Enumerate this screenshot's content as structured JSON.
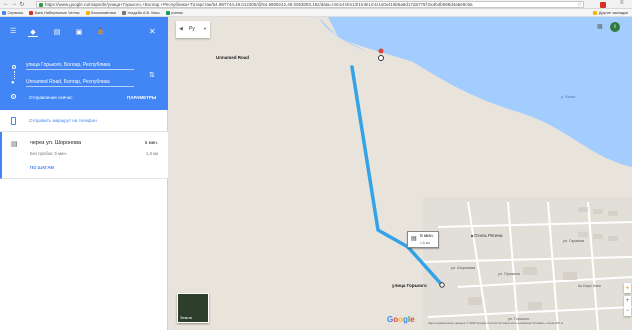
{
  "browser": {
    "back_icon": "back-arrow-icon",
    "forward_icon": "forward-arrow-icon",
    "reload_icon": "reload-icon",
    "url": "https://www.google.ru/maps/dir/улица+Горького,+Болгар,+Республика+Татарстан/54.987744,49.012305/@54.9908242,49.0053083,15z/data=!4m14!4m13!1m5!1m1!1s0x415b5a6d17da775f:0x4b4b068d4a5e9c9a",
    "bookmarks": [
      {
        "label": "Сервисы",
        "color": "#4285f4"
      },
      {
        "label": "Банк Набережные Челны",
        "color": "#d93025"
      },
      {
        "label": "Космонавтика",
        "color": "#f4b400"
      },
      {
        "label": "Усадьба А.В. Маш",
        "color": "#777777"
      },
      {
        "label": "ученик",
        "color": "#0f9d58"
      }
    ],
    "other_bookmarks": "Другие закладки"
  },
  "panel": {
    "origin": "улица Горького, Болгар, Республика",
    "destination": "Unnamed Road, Болгар, Республика",
    "depart_label": "Отправление сейчас",
    "options_label": "ПАРАМЕТРЫ",
    "send_label": "Отправить маршрут на телефон",
    "route": {
      "via": "через ул. Шоронова",
      "traffic": "Без пробок: 5 мин.",
      "duration": "5 мин.",
      "distance": "1,6 км",
      "steps_label": "ПО ШАГАМ"
    }
  },
  "map": {
    "language": "Ру",
    "labels": {
      "destination": "Unnamed Road",
      "origin": "улица Горького",
      "hotel": "Отель Регина",
      "street1": "ул. Шоронова",
      "street2": "ул. Пушкина",
      "street3": "ул. Гаражна",
      "street4": "ул. Горького",
      "shop": "Ак Барс банк",
      "river": "р. Волга"
    },
    "time_box": {
      "duration": "5 мин.",
      "distance": "1,6 км"
    },
    "earth_label": "Земля",
    "google": "Google",
    "footer": "Картографические данные © 2016 Google   Россия   Условия использования   Оставить отзыв   200 м"
  },
  "colors": {
    "accent": "#4285f4",
    "route": "#33a2e6",
    "water": "#a3ccff",
    "land": "#e8e4dc"
  }
}
